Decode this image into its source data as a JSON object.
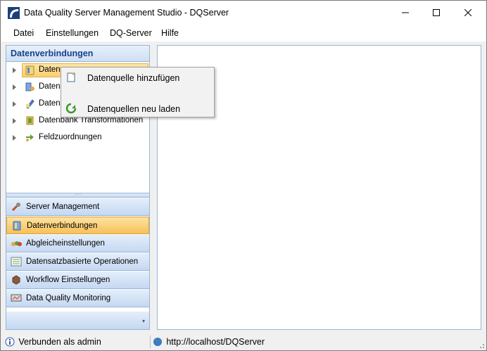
{
  "window": {
    "title": "Data Quality Server Management Studio - DQServer"
  },
  "menubar": {
    "items": [
      "Datei",
      "Einstellungen",
      "DQ-Server",
      "Hilfe"
    ]
  },
  "leftpanel": {
    "header": "Datenverbindungen",
    "tree": [
      {
        "label": "Datenquellen",
        "icon": "database-icon",
        "selected": true
      },
      {
        "label": "Datenziele",
        "icon": "target-icon",
        "selected": false
      },
      {
        "label": "Datensätze",
        "icon": "dataset-icon",
        "selected": false
      },
      {
        "label": "Datenbank Transformationen",
        "icon": "transform-icon",
        "selected": false
      },
      {
        "label": "Feldzuordnungen",
        "icon": "mapping-icon",
        "selected": false
      }
    ],
    "tree_visible_labels": [
      "Datenq",
      "Datenz",
      "Datens",
      "Datenbank Transformationen",
      "Feldzuordnungen"
    ],
    "nav": [
      {
        "label": "Server Management",
        "icon": "wrench-icon",
        "active": false
      },
      {
        "label": "Datenverbindungen",
        "icon": "datasource-icon",
        "active": true
      },
      {
        "label": "Abgleicheinstellungen",
        "icon": "match-settings-icon",
        "active": false
      },
      {
        "label": "Datensatzbasierte Operationen",
        "icon": "records-icon",
        "active": false
      },
      {
        "label": "Workflow Einstellungen",
        "icon": "workflow-icon",
        "active": false
      },
      {
        "label": "Data Quality Monitoring",
        "icon": "monitor-icon",
        "active": false
      }
    ]
  },
  "contextmenu": {
    "items": [
      {
        "label": "Datenquelle hinzufügen",
        "icon": "add-datasource-icon"
      },
      {
        "label": "Datenquellen neu laden",
        "icon": "reload-icon"
      }
    ]
  },
  "statusbar": {
    "user": "Verbunden als admin",
    "server_url": "http://localhost/DQServer"
  },
  "colors": {
    "accent": "#15428b",
    "selection": "#fbcf70",
    "panel_border": "#98b5d8"
  }
}
